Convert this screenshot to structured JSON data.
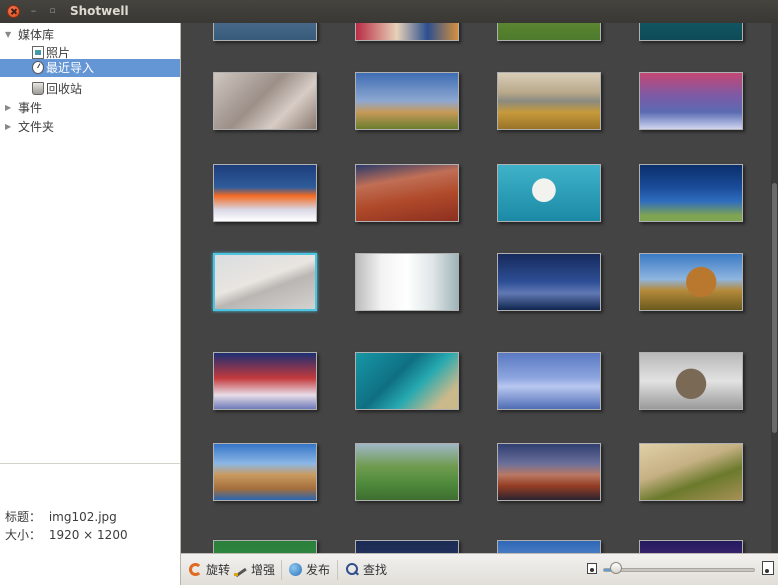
{
  "window": {
    "title": "Shotwell",
    "close_glyph": "×",
    "minimize_glyph": "–",
    "maximize_glyph": "▫"
  },
  "sidebar": {
    "library_label": "媒体库",
    "items": [
      {
        "label": "照片",
        "icon": "photos-icon"
      },
      {
        "label": "最近导入",
        "icon": "last-import-icon",
        "selected": true
      },
      {
        "label": "回收站",
        "icon": "trash-icon"
      }
    ],
    "events_label": "事件",
    "folders_label": "文件夹",
    "expander_open": "▼",
    "expander_closed": "▶"
  },
  "metadata": {
    "title_key": "标题：",
    "title_value": "img102.jpg",
    "size_key": "大小：",
    "size_value": "1920 × 1200"
  },
  "toolbar": {
    "rotate_label": "旋转",
    "enhance_label": "增强",
    "publish_label": "发布",
    "find_label": "查找",
    "zoom_level": 0.08
  },
  "colors": {
    "selection": "#6495d5",
    "selected_thumb_border": "#4fc4e0",
    "grid_bg": "#444444"
  },
  "thumbnails": [
    {
      "name": "thumb-partial-1",
      "bg": "linear-gradient(180deg,#7b9abb,#4d6d8e 60%,#375a7a)"
    },
    {
      "name": "thumb-partial-2",
      "bg": "linear-gradient(90deg,#b92c45,#e7d2b8 40%,#2c4f8f 70%,#d48f3f)"
    },
    {
      "name": "thumb-partial-3",
      "bg": "linear-gradient(180deg,#7aa03b,#4d7a2c)"
    },
    {
      "name": "thumb-partial-4",
      "bg": "linear-gradient(180deg,#1a6d7a,#0e4a57)"
    },
    {
      "name": "thumb-squirrels",
      "bg": "linear-gradient(135deg,#cfc6c0,#9b8f88 45%,#d8cdc6 70%,#8a7a70)"
    },
    {
      "name": "thumb-tree-sculpture",
      "bg": "linear-gradient(180deg,#3e6db4 0%,#8ea8d1 50%,#c79a58 70%,#6a7d2e 100%)"
    },
    {
      "name": "thumb-savanna",
      "bg": "linear-gradient(180deg,#d8cdb8 0%,#b9a98a 35%,#8a8a80 50%,#c69a3c 70%,#9a7327 100%)"
    },
    {
      "name": "thumb-ice-sunset",
      "bg": "linear-gradient(180deg,#c34775 0%,#7d5aa5 40%,#5b6bb2 70%,#cfd6f0 100%)"
    },
    {
      "name": "thumb-salt-lake",
      "bg": "linear-gradient(180deg,#1d3d7a 0%,#2f5c9b 40%,#f36b22 55%,#d9d8e6 80%,#ffffff 100%)"
    },
    {
      "name": "thumb-red-rocks-coast",
      "bg": "linear-gradient(170deg,#2a3b6b 0%,#c06f56 30%,#b04a2a 60%,#8c2f20 100%)"
    },
    {
      "name": "thumb-polar-bear",
      "bg": "radial-gradient(circle at 45% 45%,#f2f2ee 0 18%,transparent 19%),linear-gradient(180deg,#3fb2c9,#1b8aa6)"
    },
    {
      "name": "thumb-underwater-birds",
      "bg": "linear-gradient(180deg,#0b2e6a 0%,#1a4c9a 40%,#2f6dbf 65%,#7fa452 90%)"
    },
    {
      "name": "thumb-sand-dunes",
      "bg": "linear-gradient(160deg,#d9dde0 0%,#e9e5e0 45%,#b9b6b3 60%,#d4d2cf 100%)"
    },
    {
      "name": "thumb-white-room",
      "bg": "linear-gradient(90deg,#bcbcbc 0%,#f3f3f3 25%,#ffffff 50%,#dfe6e8 75%,#9fb4b8 100%)"
    },
    {
      "name": "thumb-lone-tree",
      "bg": "linear-gradient(180deg,#162a5c 0%,#2e4f96 50%,#6179b3 70%,#10264e 100%)"
    },
    {
      "name": "thumb-stone-sphere",
      "bg": "radial-gradient(circle at 60% 50%,#b9782e 0 22%,transparent 23%),linear-gradient(180deg,#3a7bc4 0%,#8fb5df 45%,#b58a3a 65%,#6a5a1e 100%)"
    },
    {
      "name": "thumb-snow-houses",
      "bg": "linear-gradient(180deg,#1d2f73 0%,#c33a3c 45%,#e8dde8 75%,#6e7ab8 100%)"
    },
    {
      "name": "thumb-reef-aerial",
      "bg": "linear-gradient(135deg,#1697a5 0%,#0f6f83 40%,#26a9b0 60%,#c9b98b 85%)"
    },
    {
      "name": "thumb-misty-church",
      "bg": "linear-gradient(180deg,#5a79c2 0%,#8ea6e0 45%,#b8c7ef 60%,#4f6db5 100%)"
    },
    {
      "name": "thumb-ram",
      "bg": "radial-gradient(circle at 50% 55%,#7a6a55 0 25%,transparent 26%),linear-gradient(180deg,#b8b8b8,#e2e2e2 50%,#9a9a9a)"
    },
    {
      "name": "thumb-azure-window",
      "bg": "linear-gradient(180deg,#3575c7 0%,#8cb7e6 35%,#c99a5f 55%,#a36e3c 80%,#2a66b1 100%)"
    },
    {
      "name": "thumb-green-hills",
      "bg": "linear-gradient(180deg,#9fb7c6 0%,#6f9b4f 40%,#4f8b3b 70%,#3e6d30 100%)"
    },
    {
      "name": "thumb-red-rock-sunset",
      "bg": "linear-gradient(180deg,#2f3f70 0%,#6b6f9a 35%,#b97964 55%,#943c23 75%,#2a2430 100%)"
    },
    {
      "name": "thumb-rolling-fields",
      "bg": "linear-gradient(160deg,#e0d0a8 0%,#c5b083 40%,#6b7a2c 65%,#a79056 100%)"
    },
    {
      "name": "thumb-partial-5",
      "bg": "linear-gradient(180deg,#2a7f3b,#3b9a4a)"
    },
    {
      "name": "thumb-partial-6",
      "bg": "linear-gradient(180deg,#1a2a52,#36477a)"
    },
    {
      "name": "thumb-partial-7",
      "bg": "linear-gradient(180deg,#2f67b7,#9cc1ea)"
    },
    {
      "name": "thumb-partial-8",
      "bg": "linear-gradient(180deg,#241a5e,#7a3aa0)"
    }
  ]
}
